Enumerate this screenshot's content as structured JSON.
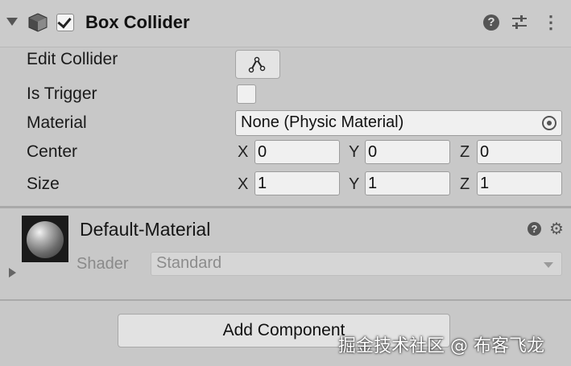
{
  "component": {
    "title": "Box Collider",
    "enabled": true,
    "icons": [
      "fold-down-icon",
      "cube-icon",
      "help-icon",
      "preset-icon",
      "kebab-menu-icon"
    ]
  },
  "properties": {
    "edit_collider": {
      "label": "Edit Collider",
      "icon": "edit-collider-icon"
    },
    "is_trigger": {
      "label": "Is Trigger",
      "checked": false
    },
    "material": {
      "label": "Material",
      "value": "None (Physic Material)"
    },
    "center": {
      "label": "Center",
      "x_label": "X",
      "x": "0",
      "y_label": "Y",
      "y": "0",
      "z_label": "Z",
      "z": "0"
    },
    "size": {
      "label": "Size",
      "x_label": "X",
      "x": "1",
      "y_label": "Y",
      "y": "1",
      "z_label": "Z",
      "z": "1"
    }
  },
  "material_section": {
    "name": "Default-Material",
    "shader_label": "Shader",
    "shader_value": "Standard"
  },
  "add_component_label": "Add Component",
  "watermark": "掘金技术社区 @ 布客飞龙"
}
